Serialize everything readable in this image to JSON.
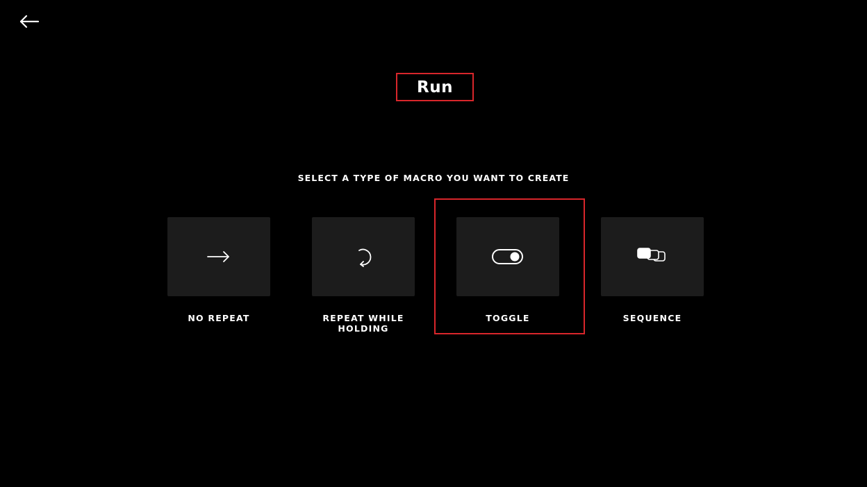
{
  "header": {
    "back_icon": "arrow-left-icon",
    "title": "Run"
  },
  "main": {
    "prompt": "SELECT A TYPE OF MACRO YOU WANT TO CREATE",
    "options": [
      {
        "label": "NO REPEAT",
        "icon": "arrow-right-icon"
      },
      {
        "label": "REPEAT WHILE\nHOLDING",
        "icon": "repeat-icon"
      },
      {
        "label": "TOGGLE",
        "icon": "toggle-icon"
      },
      {
        "label": "SEQUENCE",
        "icon": "sequence-icon"
      }
    ]
  },
  "colors": {
    "background": "#000000",
    "tile": "#1c1c1c",
    "highlight": "#d9262b",
    "text": "#ffffff"
  }
}
